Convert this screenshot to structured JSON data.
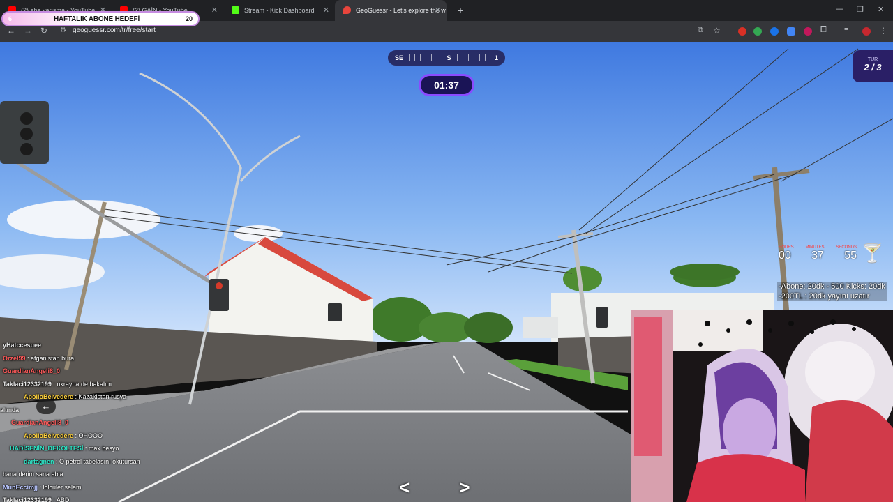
{
  "browser": {
    "tabs": [
      {
        "title": "(2) aba yarışma - YouTube",
        "favicon_color": "#ff0000"
      },
      {
        "title": "(2) GAİN - YouTube",
        "favicon_color": "#ff0000"
      },
      {
        "title": "Stream - Kick Dashboard",
        "favicon_color": "#53fc18"
      },
      {
        "title": "GeoGuessr - Let's explore the w",
        "favicon_color": "#e8453c"
      }
    ],
    "new_tab_label": "+",
    "url": "geoguessr.com/tr/free/start",
    "window_controls": [
      "—",
      "❐",
      "✕"
    ]
  },
  "goal_banner": {
    "left_count": "6",
    "text": "HAFTALIK ABONE HEDEFİ",
    "count": "20"
  },
  "game": {
    "compass": {
      "left": "SE",
      "center": "S",
      "right": "1"
    },
    "timer": "01:37",
    "round_label": "TUR",
    "round_value": "2 / 3",
    "arrows": [
      "<",
      ">"
    ]
  },
  "countdown": {
    "labels": [
      "HOURS",
      "MINUTES",
      "SECONDS"
    ],
    "values": [
      "00",
      "37",
      "55"
    ]
  },
  "sub_info": {
    "line1": "-Abone: 20dk - 500 Kicks: 20dk",
    "line2": "-200TL : 20dk yayını uzatır"
  },
  "chat": [
    {
      "user": "yHatccesuee",
      "text": "",
      "color": "#e8e8e8"
    },
    {
      "user": "Orzel99",
      "text": "afganistan bura",
      "color": "#ff5a5a"
    },
    {
      "user": "GuardianAngeli8_0",
      "text": "",
      "color": "#ff5a5a"
    },
    {
      "user": "Taklaci12332199",
      "text": "ukrayna de bakalım",
      "color": "#e8e8e8"
    },
    {
      "user": "ApolloBelvedere",
      "text": "Kazakistan rusya",
      "color": "#ffd23b"
    },
    {
      "user": "",
      "text": "altında",
      "color": "#ffffff"
    },
    {
      "user": "GuardianAngeli8_0",
      "text": "",
      "color": "#ff5a5a"
    },
    {
      "user": "ApolloBelvedere",
      "text": "OHOOO",
      "color": "#ffd23b"
    },
    {
      "user": "HADİSENİN_DEKOLTESİ",
      "text": "max besyo",
      "color": "#2ee6c8"
    },
    {
      "user": "dartagnen",
      "text": "O petrol tabelasını okutursan",
      "color": "#2ee6c8"
    },
    {
      "user": "",
      "text": "bana derim sana abla",
      "color": "#ffffff"
    },
    {
      "user": "MunEccimjj",
      "text": "lolculer selam",
      "color": "#b9c6ff"
    },
    {
      "user": "Taklaci12332199",
      "text": "ABD",
      "color": "#e8e8e8"
    }
  ]
}
